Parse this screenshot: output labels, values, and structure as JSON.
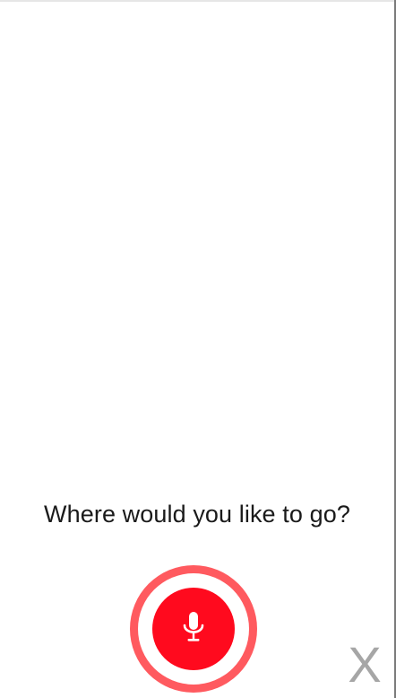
{
  "prompt": {
    "text": "Where would you like to go?"
  },
  "mic": {
    "icon": "microphone-icon",
    "ring_color": "#ff5a5f",
    "button_color": "#ff0a1e"
  },
  "close": {
    "label": "X",
    "color": "#a6a6a6"
  }
}
